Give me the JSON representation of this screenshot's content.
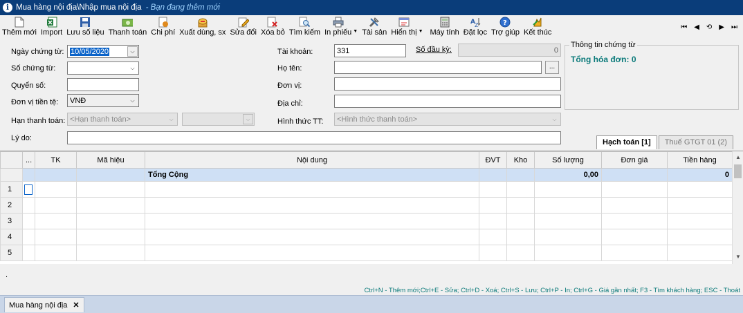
{
  "window": {
    "title": "Mua hàng nội địa\\Nhập mua nội địa",
    "status": " - Bạn đang thêm mới"
  },
  "toolbar": {
    "items": [
      {
        "label": "Thêm mới",
        "icon": "new-document-icon"
      },
      {
        "label": "Import",
        "icon": "excel-import-icon"
      },
      {
        "label": "Lưu số liệu",
        "icon": "save-icon"
      },
      {
        "label": "Thanh toán",
        "icon": "payment-icon"
      },
      {
        "label": "Chi phí",
        "icon": "cost-icon"
      },
      {
        "label": "Xuất dùng, sx",
        "icon": "export-usage-icon"
      },
      {
        "label": "Sửa đổi",
        "icon": "edit-icon"
      },
      {
        "label": "Xóa bỏ",
        "icon": "delete-icon"
      },
      {
        "label": "Tìm kiếm",
        "icon": "search-icon"
      },
      {
        "label": "In phiếu",
        "icon": "print-icon"
      },
      {
        "label": "Tài sản",
        "icon": "tools-icon"
      },
      {
        "label": "Hiển thị",
        "icon": "display-icon"
      },
      {
        "label": "Máy tính",
        "icon": "calculator-icon"
      },
      {
        "label": "Đặt lọc",
        "icon": "filter-icon"
      },
      {
        "label": "Trợ giúp",
        "icon": "help-icon"
      },
      {
        "label": "Kết thúc",
        "icon": "exit-icon"
      }
    ],
    "nav": [
      "⏮",
      "◀",
      "⟲",
      "▶",
      "⏭"
    ]
  },
  "form": {
    "ngay_chung_tu": {
      "label": "Ngày chứng từ:",
      "value": "10/05/2020"
    },
    "so_chung_tu": {
      "label": "Số chứng từ:",
      "value": ""
    },
    "quyen_so": {
      "label": "Quyển số:",
      "value": ""
    },
    "don_vi_tien_te": {
      "label": "Đơn vị tiền tệ:",
      "value": "VNĐ"
    },
    "han_thanh_toan": {
      "label": "Hạn thanh toán:",
      "placeholder": "<Hạn thanh toán>"
    },
    "ly_do": {
      "label": "Lý do:",
      "value": ""
    },
    "tai_khoan": {
      "label": "Tài khoản:",
      "value": "331"
    },
    "so_dau_ky": {
      "label": "Số đầu kỳ:",
      "value": "0"
    },
    "ho_ten": {
      "label": "Họ tên:",
      "value": "",
      "button": "..."
    },
    "don_vi": {
      "label": "Đơn vị:",
      "value": ""
    },
    "dia_chi": {
      "label": "Địa chỉ:",
      "value": ""
    },
    "hinh_thuc_tt": {
      "label": "Hình thức TT:",
      "placeholder": "<Hình thức thanh toán>"
    }
  },
  "info": {
    "legend": "Thông tin chứng từ",
    "total": "Tổng hóa đơn: 0"
  },
  "tabs": [
    {
      "label": "Hạch toán [1]",
      "active": true
    },
    {
      "label": "Thuế GTGT 01 (2)",
      "active": false
    }
  ],
  "grid": {
    "columns": [
      "...",
      "TK",
      "Mã hiệu",
      "Nội dung",
      "ĐVT",
      "Kho",
      "Số lượng",
      "Đơn giá",
      "Tiền hàng"
    ],
    "total_row": {
      "label": "Tổng Cộng",
      "so_luong": "0,00",
      "tien_hang": "0"
    },
    "row_numbers": [
      "1",
      "2",
      "3",
      "4",
      "5"
    ]
  },
  "footer": {
    "dot": ".",
    "shortcuts": "Ctrl+N - Thêm mới;Ctrl+E - Sửa; Ctrl+D - Xoá; Ctrl+S - Lưu; Ctrl+P - In; Ctrl+G - Giá gần nhất; F3 - Tìm khách hàng; ESC - Thoát",
    "tab_label": "Mua hàng nội địa",
    "tab_close": "✕"
  }
}
